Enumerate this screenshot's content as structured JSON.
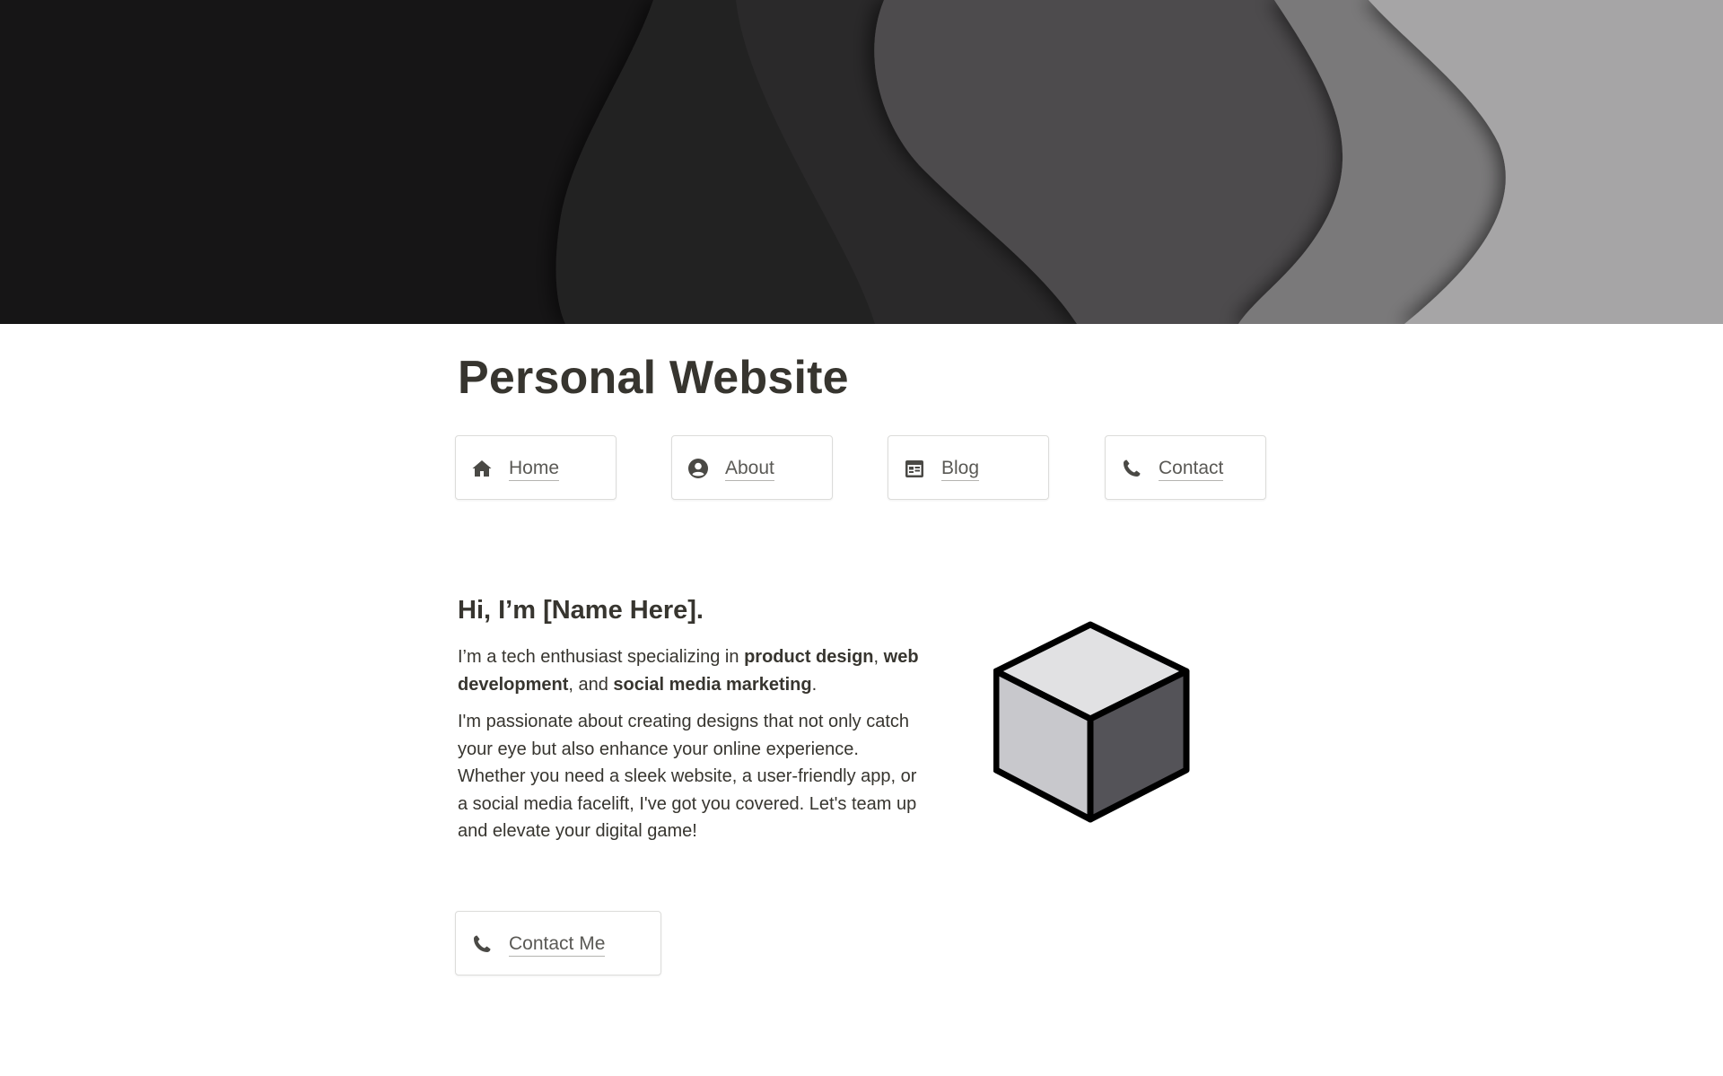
{
  "cover": {
    "description_icon": "abstract-wave-cover",
    "colors": [
      "#161516",
      "#232223",
      "#4d4c4d",
      "#7a797a",
      "#a6a5a6"
    ]
  },
  "page": {
    "title": "Personal Website"
  },
  "nav": {
    "items": [
      {
        "label": "Home",
        "icon": "home-icon"
      },
      {
        "label": "About",
        "icon": "user-circle-icon"
      },
      {
        "label": "Blog",
        "icon": "calendar-icon"
      },
      {
        "label": "Contact",
        "icon": "phone-icon"
      }
    ]
  },
  "intro": {
    "heading": "Hi, I’m [Name Here].",
    "line_prefix": "I’m a tech enthusiast specializing in ",
    "skill_1": "product design",
    "sep_1": ", ",
    "skill_2": "web development",
    "sep_2": ", and ",
    "skill_3": "social media marketing",
    "line_suffix": ".",
    "body": "I'm passionate about creating designs that not only catch your eye but also enhance your online experience. Whether you need a sleek website, a user-friendly app, or a social media facelift, I've got you covered. Let's team up and elevate your digital game!"
  },
  "illustration": {
    "icon": "cube-icon",
    "colors": {
      "top": "#e1e1e3",
      "left": "#c8c8cc",
      "right": "#545358",
      "stroke": "#000000"
    }
  },
  "cta": {
    "label": "Contact Me",
    "icon": "phone-icon"
  }
}
